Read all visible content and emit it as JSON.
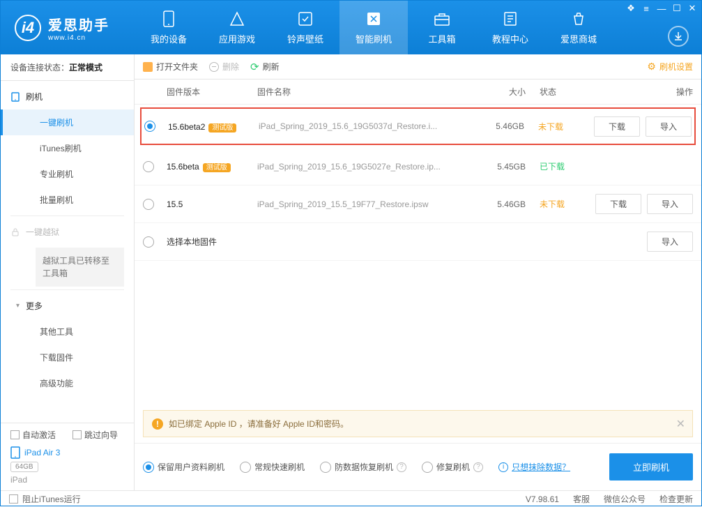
{
  "app": {
    "name": "爱思助手",
    "url": "www.i4.cn"
  },
  "nav": [
    {
      "label": "我的设备"
    },
    {
      "label": "应用游戏"
    },
    {
      "label": "铃声壁纸"
    },
    {
      "label": "智能刷机",
      "active": true
    },
    {
      "label": "工具箱"
    },
    {
      "label": "教程中心"
    },
    {
      "label": "爱思商城"
    }
  ],
  "connection": {
    "prefix": "设备连接状态：",
    "status": "正常模式"
  },
  "sidebar": {
    "flash": "刷机",
    "items1": [
      "一键刷机",
      "iTunes刷机",
      "专业刷机",
      "批量刷机"
    ],
    "jailbreak": "一键越狱",
    "jailbreak_note": "越狱工具已转移至工具箱",
    "more": "更多",
    "items2": [
      "其他工具",
      "下载固件",
      "高级功能"
    ]
  },
  "device_panel": {
    "auto_activate": "自动激活",
    "skip_guide": "跳过向导",
    "name": "iPad Air 3",
    "badge": "64GB",
    "type": "iPad"
  },
  "toolbar": {
    "open": "打开文件夹",
    "delete": "删除",
    "refresh": "刷新",
    "settings": "刷机设置"
  },
  "columns": {
    "version": "固件版本",
    "name": "固件名称",
    "size": "大小",
    "status": "状态",
    "ops": "操作"
  },
  "rows": [
    {
      "selected": true,
      "highlighted": true,
      "version": "15.6beta2",
      "beta": true,
      "name": "iPad_Spring_2019_15.6_19G5037d_Restore.i...",
      "size": "5.46GB",
      "status": "未下载",
      "status_class": "nd",
      "ops": [
        "下载",
        "导入"
      ]
    },
    {
      "selected": false,
      "version": "15.6beta",
      "beta": true,
      "name": "iPad_Spring_2019_15.6_19G5027e_Restore.ip...",
      "size": "5.45GB",
      "status": "已下载",
      "status_class": "dl",
      "ops": []
    },
    {
      "selected": false,
      "version": "15.5",
      "beta": false,
      "name": "iPad_Spring_2019_15.5_19F77_Restore.ipsw",
      "size": "5.46GB",
      "status": "未下载",
      "status_class": "nd",
      "ops": [
        "下载",
        "导入"
      ]
    },
    {
      "local": true,
      "label": "选择本地固件",
      "ops": [
        "导入"
      ]
    }
  ],
  "beta_tag": "测试版",
  "banner": "如已绑定 Apple ID ，请准备好 Apple ID和密码。",
  "flash_options": [
    "保留用户资料刷机",
    "常规快速刷机",
    "防数据恢复刷机",
    "修复刷机"
  ],
  "erase_link": "只想抹除数据？",
  "flash_btn": "立即刷机",
  "footer": {
    "block_itunes": "阻止iTunes运行",
    "version": "V7.98.61",
    "links": [
      "客服",
      "微信公众号",
      "检查更新"
    ]
  }
}
